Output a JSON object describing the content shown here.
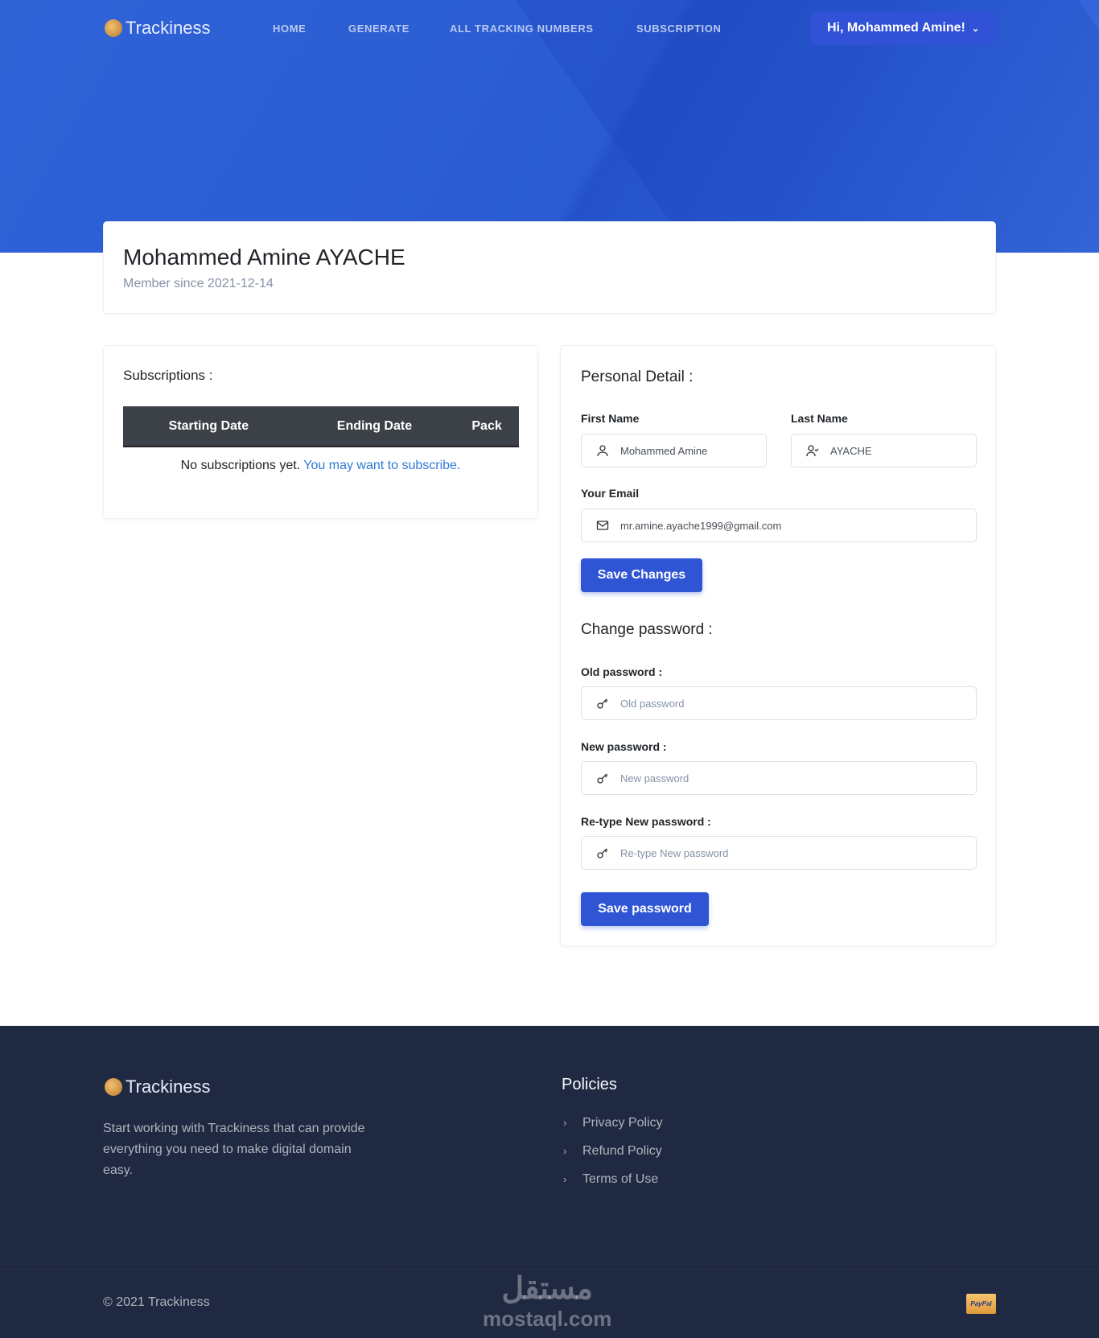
{
  "brand": "Trackiness",
  "nav": {
    "items": [
      "HOME",
      "GENERATE",
      "ALL TRACKING NUMBERS",
      "SUBSCRIPTION"
    ],
    "user_greeting": "Hi, Mohammed Amine!"
  },
  "profile": {
    "name": "Mohammed Amine AYACHE",
    "member_since": "Member since 2021-12-14"
  },
  "subscriptions": {
    "title": "Subscriptions :",
    "columns": [
      "Starting Date",
      "Ending Date",
      "Pack"
    ],
    "empty_text": "No subscriptions yet.",
    "empty_link": "You may want to subscribe."
  },
  "personal": {
    "title": "Personal Detail :",
    "first_name_label": "First Name",
    "first_name": "Mohammed Amine",
    "last_name_label": "Last Name",
    "last_name": "AYACHE",
    "email_label": "Your Email",
    "email": "mr.amine.ayache1999@gmail.com",
    "save_label": "Save Changes"
  },
  "password": {
    "title": "Change password :",
    "old_label": "Old password :",
    "old_placeholder": "Old password",
    "new_label": "New password :",
    "new_placeholder": "New password",
    "retype_label": "Re-type New password :",
    "retype_placeholder": "Re-type New password",
    "save_label": "Save password"
  },
  "footer": {
    "description": "Start working with Trackiness that can provide everything you need to make digital domain easy.",
    "policies_title": "Policies",
    "policies": [
      "Privacy Policy",
      "Refund Policy",
      "Terms of Use"
    ],
    "copyright": "© 2021 Trackiness",
    "payment": "PayPal",
    "watermark_ar": "مستقل",
    "watermark": "mostaql.com"
  },
  "colors": {
    "primary": "#2f55d4",
    "hero": "#2a5bd3",
    "footer": "#202942",
    "link": "#2f7ad6"
  }
}
